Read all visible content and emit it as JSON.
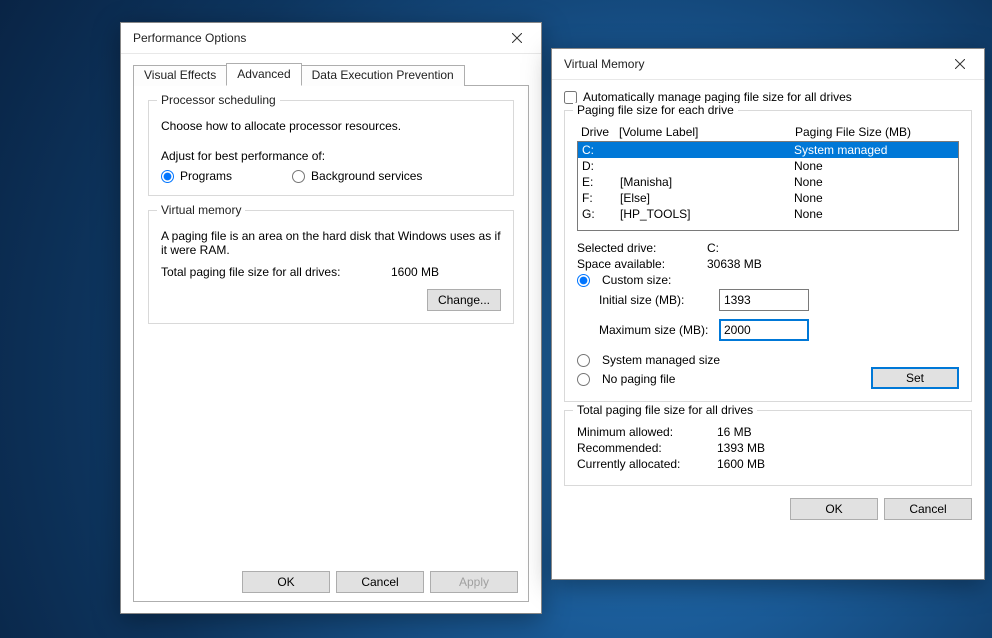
{
  "performance": {
    "title": "Performance Options",
    "tabs": [
      "Visual Effects",
      "Advanced",
      "Data Execution Prevention"
    ],
    "processor": {
      "legend": "Processor scheduling",
      "desc": "Choose how to allocate processor resources.",
      "adjust_label": "Adjust for best performance of:",
      "options": [
        "Programs",
        "Background services"
      ]
    },
    "virtual": {
      "legend": "Virtual memory",
      "desc": "A paging file is an area on the hard disk that Windows uses as if it were RAM.",
      "total_label": "Total paging file size for all drives:",
      "total_value": "1600 MB",
      "change_label": "Change..."
    },
    "buttons": {
      "ok": "OK",
      "cancel": "Cancel",
      "apply": "Apply"
    }
  },
  "virtual": {
    "title": "Virtual Memory",
    "auto_manage": "Automatically manage paging file size for all drives",
    "each_drive": {
      "legend": "Paging file size for each drive",
      "header": {
        "drive": "Drive",
        "label": "[Volume Label]",
        "size": "Paging File Size (MB)"
      },
      "rows": [
        {
          "drive": "C:",
          "label": "",
          "size": "System managed"
        },
        {
          "drive": "D:",
          "label": "",
          "size": "None"
        },
        {
          "drive": "E:",
          "label": "[Manisha]",
          "size": "None"
        },
        {
          "drive": "F:",
          "label": "[Else]",
          "size": "None"
        },
        {
          "drive": "G:",
          "label": "[HP_TOOLS]",
          "size": "None"
        }
      ]
    },
    "selected": {
      "drive_label": "Selected drive:",
      "drive_value": "C:",
      "space_label": "Space available:",
      "space_value": "30638 MB"
    },
    "mode": {
      "custom": "Custom size:",
      "system": "System managed size",
      "none": "No paging file"
    },
    "custom": {
      "initial_label": "Initial size (MB):",
      "initial_value": "1393",
      "max_label": "Maximum size (MB):",
      "max_value": "2000"
    },
    "set_label": "Set",
    "total": {
      "legend": "Total paging file size for all drives",
      "min_label": "Minimum allowed:",
      "min_value": "16 MB",
      "rec_label": "Recommended:",
      "rec_value": "1393 MB",
      "cur_label": "Currently allocated:",
      "cur_value": "1600 MB"
    },
    "buttons": {
      "ok": "OK",
      "cancel": "Cancel"
    }
  }
}
